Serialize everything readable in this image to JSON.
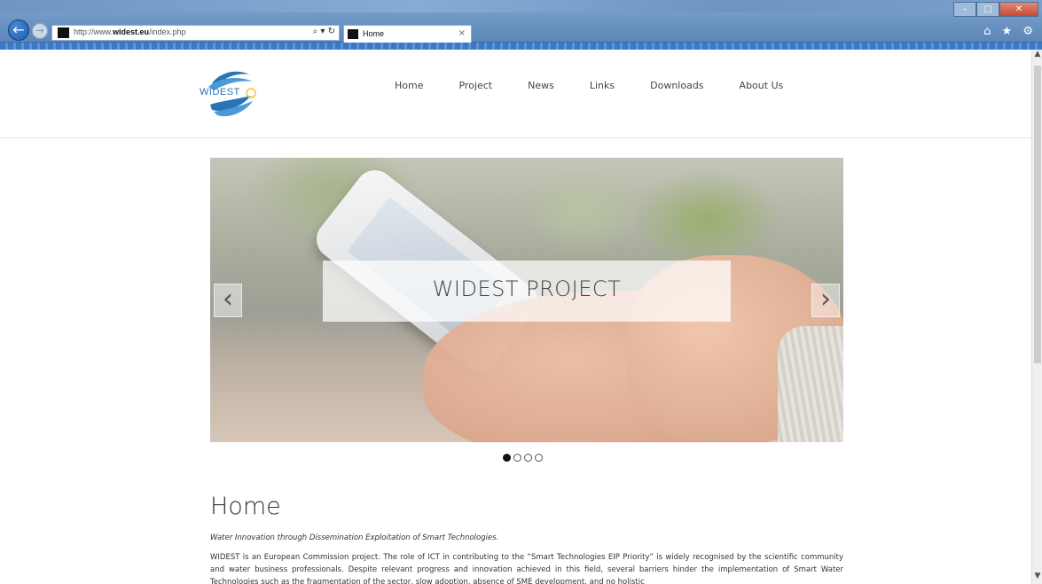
{
  "browser": {
    "url_prefix": "http://www.",
    "url_domain": "widest.eu",
    "url_path": "/index.php",
    "address_icons": "⌕ ▾ ↻",
    "tab_title": "Home",
    "tab_close": "×",
    "minimize": "–",
    "maximize": "□",
    "close": "✕",
    "toolbar_icons": "⌂ ★ ⚙"
  },
  "site": {
    "logo_text": "WIDEST",
    "nav": [
      "Home",
      "Project",
      "News",
      "Links",
      "Downloads",
      "About Us"
    ]
  },
  "slider": {
    "caption": "WIDEST PROJECT",
    "prev": "‹",
    "next": "›",
    "slide_count": 4,
    "active_slide": 1
  },
  "content": {
    "title": "Home",
    "subtitle": "Water Innovation through Dissemination Exploitation of Smart Technologies.",
    "body": "WIDEST is an European Commission project. The role of ICT in contributing to the “Smart Technologies EIP Priority” is widely recognised by the scientific community and water business professionals. Despite relevant progress and innovation achieved in this field, several barriers hinder the implementation of Smart Water Technologies such as the fragmentation of the sector, slow adoption, absence of SME development, and no holistic"
  },
  "colors": {
    "nav_text": "#444444",
    "logo_blue": "#2a73b5",
    "title_text": "#333333"
  }
}
